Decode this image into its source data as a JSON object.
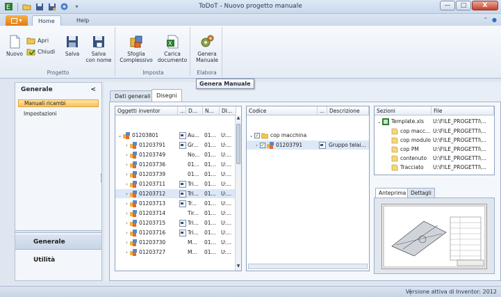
{
  "window": {
    "title": "ToDoT - Nuovo progetto manuale",
    "minimize": "—",
    "maximize": "□",
    "close": "X"
  },
  "ribbon": {
    "tabs": [
      {
        "label": "Home"
      },
      {
        "label": "Help"
      }
    ],
    "groups": {
      "progetto": {
        "label": "Progetto",
        "nuovo": "Nuovo",
        "apri": "Apri",
        "chiudi": "Chiudi",
        "salva": "Salva",
        "salva_con_nome_1": "Salva",
        "salva_con_nome_2": "con nome"
      },
      "imposta": {
        "label": "Imposta",
        "sfoglia_1": "Sfoglia",
        "sfoglia_2": "Complessivo",
        "carica_1": "Carica",
        "carica_2": "documento"
      },
      "elabora": {
        "label": "Elabora",
        "genera_1": "Genera",
        "genera_2": "Manuale"
      }
    },
    "tooltip": "Genera Manuale"
  },
  "left_panel": {
    "header": "Generale",
    "collapse": "<",
    "items": [
      {
        "label": "Manuali ricambi",
        "selected": true
      },
      {
        "label": "Impostazioni",
        "selected": false
      }
    ],
    "bottom_buttons": [
      {
        "label": "Generale"
      },
      {
        "label": "Utilità"
      }
    ]
  },
  "main_tabs": [
    {
      "label": "Dati generali",
      "active": false
    },
    {
      "label": "Disegni",
      "active": true
    }
  ],
  "inventor_grid": {
    "columns": [
      "Oggetti inventor",
      "...",
      "D...",
      "N...",
      "DI..."
    ],
    "root": {
      "code": "01203801",
      "d": "Au...",
      "n": "01...",
      "di": "U:..."
    },
    "rows": [
      {
        "code": "01203791",
        "has_icon": true,
        "d": "Gr...",
        "n": "01...",
        "di": "U:...",
        "selected": false
      },
      {
        "code": "01203749",
        "has_icon": false,
        "d": "No...",
        "n": "01...",
        "di": "U:...",
        "selected": false
      },
      {
        "code": "01203736",
        "has_icon": false,
        "d": "01...",
        "n": "01...",
        "di": "U:...",
        "selected": false
      },
      {
        "code": "01203739",
        "has_icon": false,
        "d": "01...",
        "n": "01...",
        "di": "U:...",
        "selected": false
      },
      {
        "code": "01203711",
        "has_icon": true,
        "d": "Tri...",
        "n": "01...",
        "di": "U:...",
        "selected": false
      },
      {
        "code": "01203712",
        "has_icon": true,
        "d": "Tri...",
        "n": "01...",
        "di": "U:...",
        "selected": true
      },
      {
        "code": "01203713",
        "has_icon": true,
        "d": "Tr...",
        "n": "01...",
        "di": "U:...",
        "selected": false
      },
      {
        "code": "01203714",
        "has_icon": false,
        "d": "Tir...",
        "n": "01...",
        "di": "U:...",
        "selected": false
      },
      {
        "code": "01203715",
        "has_icon": true,
        "d": "Tri...",
        "n": "01...",
        "di": "U:...",
        "selected": false
      },
      {
        "code": "01203716",
        "has_icon": true,
        "d": "Tri...",
        "n": "01...",
        "di": "U:...",
        "selected": false
      },
      {
        "code": "01203730",
        "has_icon": false,
        "d": "M...",
        "n": "01...",
        "di": "U:...",
        "selected": false
      },
      {
        "code": "01203727",
        "has_icon": false,
        "d": "M...",
        "n": "01...",
        "di": "U:...",
        "selected": false
      }
    ]
  },
  "codice_grid": {
    "columns": [
      "Codice",
      "...",
      "Descrizione"
    ],
    "rows": [
      {
        "code": "cop macchina",
        "description": ""
      },
      {
        "code": "01203791",
        "description": "Gruppo telai..."
      }
    ]
  },
  "sezioni_grid": {
    "columns": [
      "Sezioni",
      "File"
    ],
    "root": {
      "name": "Template.xls",
      "file": "U:\\FILE_PROGETTI\\..."
    },
    "rows": [
      {
        "name": "cop macc...",
        "file": "U:\\FILE_PROGETTI\\..."
      },
      {
        "name": "cop modulo",
        "file": "U:\\FILE_PROGETTI\\..."
      },
      {
        "name": "cop PM",
        "file": "U:\\FILE_PROGETTI\\..."
      },
      {
        "name": "contenuto",
        "file": "U:\\FILE_PROGETTI\\..."
      },
      {
        "name": "Tracciato",
        "file": "U:\\FILE_PROGETTI\\..."
      }
    ]
  },
  "preview_tabs": [
    {
      "label": "Anteprima",
      "active": true
    },
    {
      "label": "Dettagli",
      "active": false
    }
  ],
  "status": {
    "text": "Versione attiva di Inventor: 2012"
  }
}
